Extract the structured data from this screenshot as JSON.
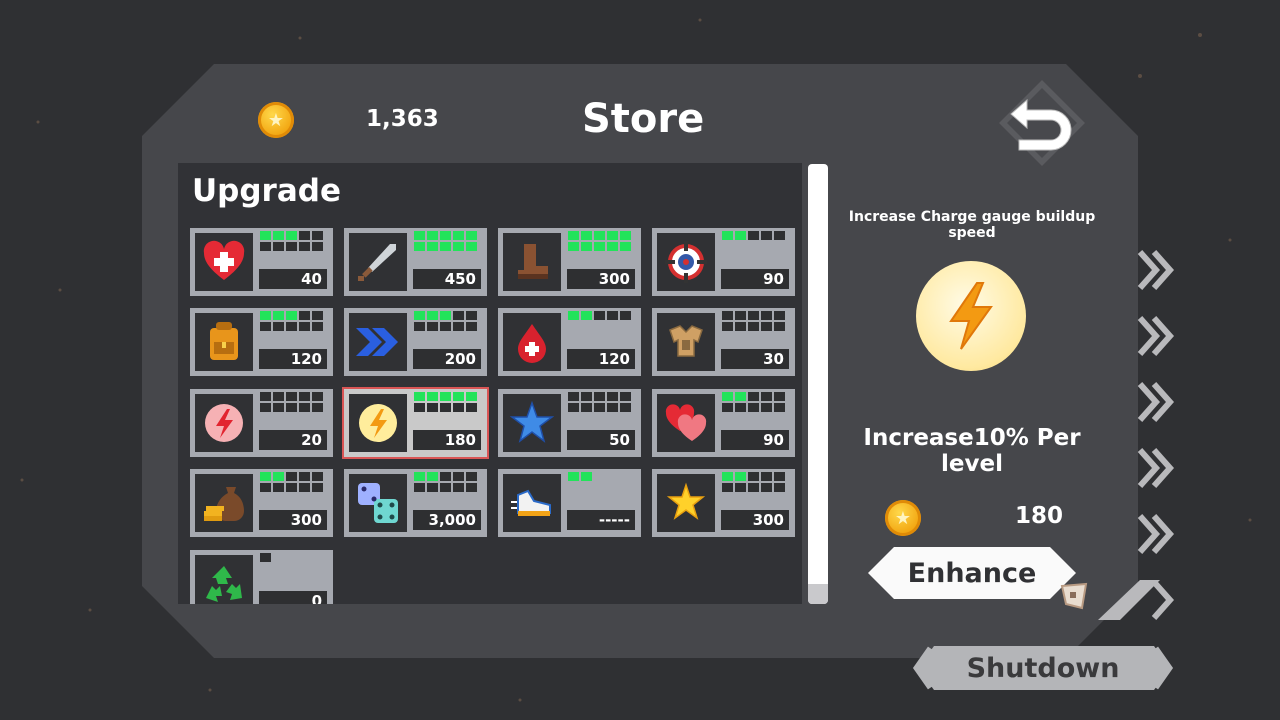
{
  "header": {
    "coins": "1,363",
    "title": "Store"
  },
  "section": {
    "title": "Upgrade"
  },
  "cards": [
    {
      "icon": "heart-plus-icon",
      "price": "40",
      "filled": 3,
      "total": 10
    },
    {
      "icon": "sword-icon",
      "price": "450",
      "filled": 10,
      "total": 10
    },
    {
      "icon": "boot-icon",
      "price": "300",
      "filled": 10,
      "total": 10
    },
    {
      "icon": "crosshair-icon",
      "price": "90",
      "filled": 2,
      "total": 5
    },
    {
      "icon": "backpack-icon",
      "price": "120",
      "filled": 3,
      "total": 10
    },
    {
      "icon": "chevrons-icon",
      "price": "200",
      "filled": 3,
      "total": 10
    },
    {
      "icon": "blood-drop-icon",
      "price": "120",
      "filled": 2,
      "total": 5
    },
    {
      "icon": "armor-icon",
      "price": "30",
      "filled": 0,
      "total": 10
    },
    {
      "icon": "lightning-pink-icon",
      "price": "20",
      "filled": 0,
      "total": 10
    },
    {
      "icon": "lightning-gold-icon",
      "price": "180",
      "filled": 5,
      "total": 10
    },
    {
      "icon": "star-blue-icon",
      "price": "50",
      "filled": 0,
      "total": 10
    },
    {
      "icon": "hearts-icon",
      "price": "90",
      "filled": 2,
      "total": 10
    },
    {
      "icon": "money-bag-icon",
      "price": "300",
      "filled": 2,
      "total": 10
    },
    {
      "icon": "dice-icon",
      "price": "3,000",
      "filled": 2,
      "total": 10
    },
    {
      "icon": "sneaker-icon",
      "price": "-----",
      "filled": 2,
      "total": 2
    },
    {
      "icon": "star-gold-icon",
      "price": "300",
      "filled": 2,
      "total": 10
    },
    {
      "icon": "recycle-icon",
      "price": "0",
      "filled": 0,
      "total": 1
    }
  ],
  "selected_index": 9,
  "detail": {
    "description": "Increase Charge gauge buildup speed",
    "effect": "Increase10% Per level",
    "cost": "180",
    "icon": "lightning-gold-icon"
  },
  "buttons": {
    "enhance": "Enhance",
    "shutdown": "Shutdown"
  },
  "colors": {
    "level_on": "#22e35a",
    "level_off": "#2e2f31",
    "card_bg": "#a6a9b0",
    "panel": "#46474b",
    "selected_outline": "#d95555"
  }
}
